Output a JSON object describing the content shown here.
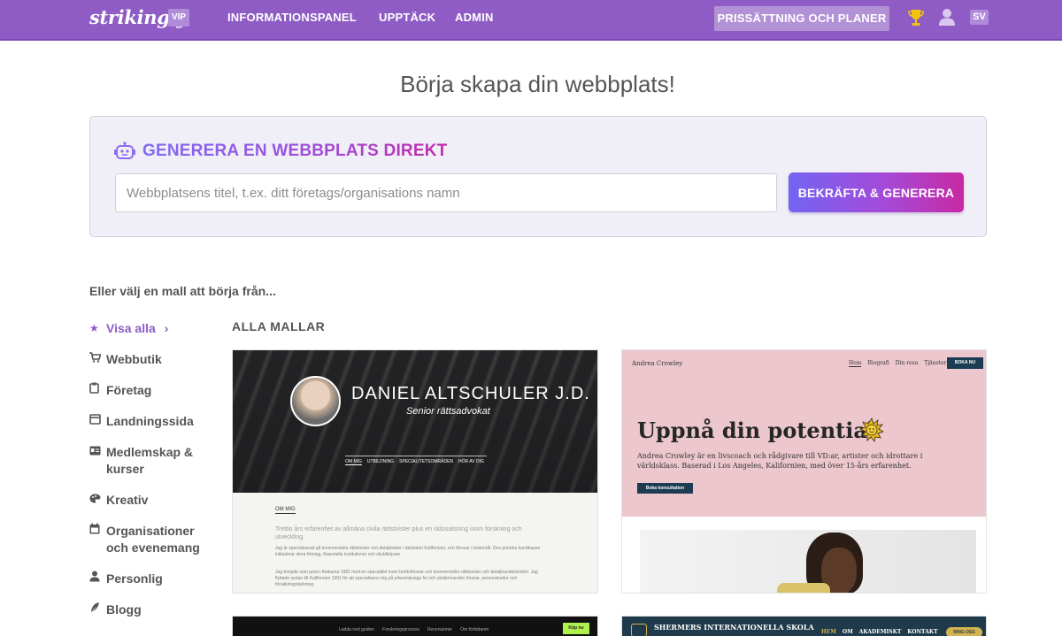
{
  "header": {
    "logo": "strikingly",
    "vip_badge": "VIP",
    "nav": [
      "INFORMATIONSPANEL",
      "UPPTÄCK",
      "ADMIN"
    ],
    "pricing_button": "PRISSÄTTNING OCH PLANER",
    "trophy_icon": "trophy-icon",
    "user_icon": "user-icon",
    "language": "SV"
  },
  "headline": "Börja skapa din webbplats!",
  "generator": {
    "title": "GENERERA EN WEBBPLATS DIREKT",
    "icon": "robot-icon",
    "input_value": "",
    "input_placeholder": "Webbplatsens titel, t.ex. ditt företags/organisations namn",
    "button": "BEKRÄFTA & GENERERA"
  },
  "templates": {
    "intro": "Eller välj en mall att börja från...",
    "section_title": "ALLA MALLAR",
    "active_category": "Visa alla",
    "categories": [
      {
        "label": "Visa alla",
        "icon": "star-icon"
      },
      {
        "label": "Webbutik",
        "icon": "cart-icon"
      },
      {
        "label": "Företag",
        "icon": "clipboard-icon"
      },
      {
        "label": "Landningssida",
        "icon": "browser-window-icon"
      },
      {
        "label": "Medlemskap & kurser",
        "icon": "id-card-icon"
      },
      {
        "label": "Kreativ",
        "icon": "palette-icon"
      },
      {
        "label": "Organisationer och evenemang",
        "icon": "calendar-icon"
      },
      {
        "label": "Personlig",
        "icon": "person-icon"
      },
      {
        "label": "Blogg",
        "icon": "feather-icon"
      }
    ],
    "cards": [
      {
        "name": "DANIEL ALTSCHULER J.D.",
        "subtitle": "Senior rättsadvokat",
        "nav": [
          "OM MIG",
          "UTBILDNING",
          "SPECIALITETSOMRÅDEN",
          "HÖR AV DIG"
        ],
        "section_heading": "OM MIG",
        "paragraphs": [
          "Trettio års erfarenhet av allmäna civila rättstvister plus en sidosatsning inom forskning och utveckling.",
          "Jag är specialiserad på kommersiella rättstvister och detaljtvister i delstaten Kalifornien, och försvar i tvistemål. Den primära kundbasen inkluderar stora företag, finansiella institutioner och skuldköpare.",
          "Jag började som jurist i Alabama 1981 med en specialitet inom brottsförsvar och kommersiella rättstvister och detaljhandelstvister. Jag flyttade sedan till Kalifornien 1991 för att specialisera mig på yrkesmässiga fel och utelämnanden försvar, personskador och försäkringstäckning."
        ]
      },
      {
        "logo": "Andrea Crowley",
        "nav": [
          "Hem",
          "Biografi",
          "Din resa",
          "Tjänster"
        ],
        "book_button": "BOKA NU",
        "heading": "Uppnå din potential",
        "body": "Andrea Crowley är en livscoach och rådgivare till VD:ar, artister och idrottare i världsklass. Baserad i Los Angeles, Kalifornien, med över 15-års erfarenhet.",
        "cta": "Boka konsultation"
      },
      {
        "nav": [
          "Ladda ned guiden",
          "Forskningsprocess",
          "Recensioner",
          "Om författaren"
        ],
        "buy_button": "Köp nu"
      },
      {
        "name": "SHERMERS INTERNATIONELLA SKOLA",
        "nav": [
          "HEM",
          "OM",
          "AKADEMISKT",
          "KONTAKT"
        ],
        "call_button": "RING OSS"
      }
    ]
  }
}
